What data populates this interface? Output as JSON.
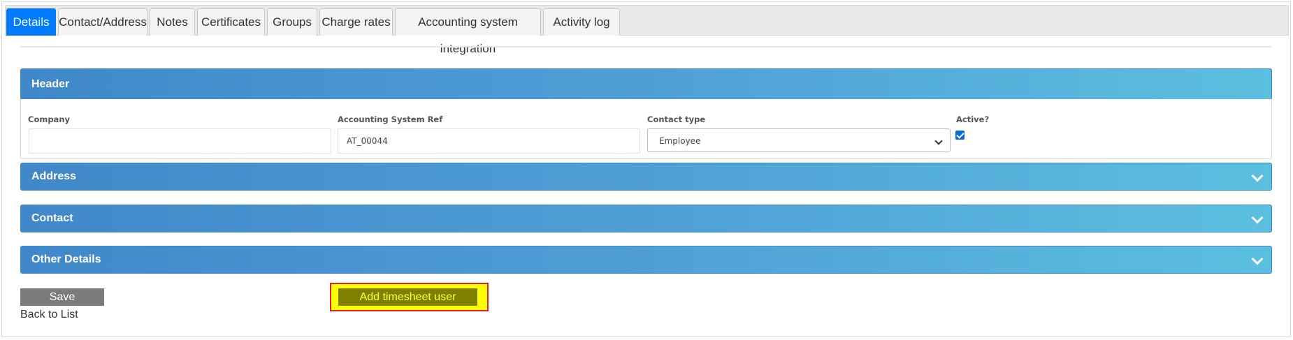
{
  "tabs": [
    {
      "label": "Details",
      "active": true
    },
    {
      "label": "Contact/Address",
      "active": false
    },
    {
      "label": "Notes",
      "active": false
    },
    {
      "label": "Certificates",
      "active": false
    },
    {
      "label": "Groups",
      "active": false
    },
    {
      "label": "Charge rates",
      "active": false
    },
    {
      "label": "Accounting system integration",
      "active": false
    },
    {
      "label": "Activity log",
      "active": false
    }
  ],
  "sections": {
    "header": {
      "title": "Header",
      "expanded": true
    },
    "address": {
      "title": "Address",
      "expanded": false
    },
    "contact": {
      "title": "Contact",
      "expanded": false
    },
    "other_details": {
      "title": "Other Details",
      "expanded": false
    }
  },
  "fields": {
    "company": {
      "label": "Company",
      "value": ""
    },
    "accounting_ref": {
      "label": "Accounting System Ref",
      "value": "AT_00044"
    },
    "contact_type": {
      "label": "Contact type",
      "value": "Employee"
    },
    "active": {
      "label": "Active?",
      "checked": true
    }
  },
  "actions": {
    "save": "Save",
    "back_to_list": "Back to List",
    "add_timesheet_user": "Add timesheet user"
  },
  "colors": {
    "active_tab": "#007bff",
    "panel_gradient_start": "#4088c9",
    "panel_gradient_end": "#5bbfdf",
    "save_button": "#7b7b7b",
    "highlight_fill": "#ffff00",
    "highlight_border": "#e0202b",
    "add_button": "#808000"
  },
  "icons": {
    "section_toggle": "chevron-down-icon",
    "select_arrow": "chevron-down-icon",
    "checkbox": "checkmark-icon"
  }
}
